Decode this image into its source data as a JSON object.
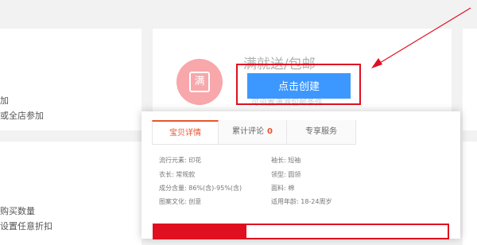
{
  "left_fragments": {
    "top_line1": "加",
    "top_line2": "或全店参加",
    "bottom_line1": "购买数量",
    "bottom_line2": "设置任意折扣"
  },
  "promo": {
    "icon_char": "满",
    "title": "满就送/包邮",
    "ghost_text": "可设置满减包邮条件",
    "create_label": "点击创建"
  },
  "popup": {
    "tabs": [
      {
        "label": "宝贝详情"
      },
      {
        "label": "累计评论",
        "count": "0"
      },
      {
        "label": "专享服务"
      }
    ],
    "attributes": [
      "流行元素: 印花",
      "袖长: 短袖",
      "衣长: 常规款",
      "领型: 圆领",
      "成分含量: 86%(含)-95%(含)",
      "面料: 棉",
      "图案文化: 创意",
      "适用年龄: 18-24周岁"
    ]
  },
  "colors": {
    "accent_blue": "#3c98ff",
    "highlight_red": "#e01020",
    "tab_active": "#e8552d",
    "icon_pink": "#f8a7aa"
  }
}
